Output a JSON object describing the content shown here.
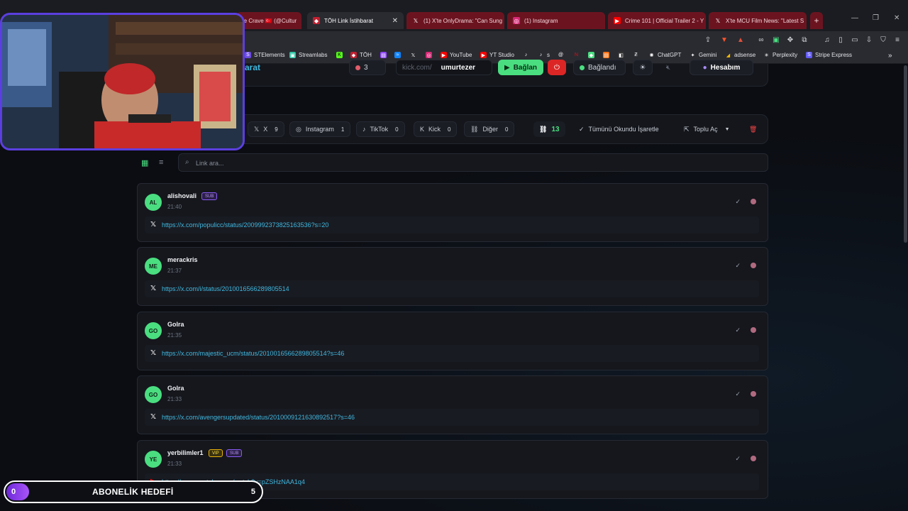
{
  "browser": {
    "tabs": [
      {
        "label": "re Crave 🇹🇷 (@Cultur",
        "active": false
      },
      {
        "label": "TÖH Link İstihbarat",
        "active": true
      },
      {
        "label": "(1) X'te OnlyDrama: \"Can Sung",
        "active": false
      },
      {
        "label": "(1) Instagram",
        "active": false
      },
      {
        "label": "Crime 101 | Official Trailer 2 - Y",
        "active": false
      },
      {
        "label": "X'te MCU Film News: \"Latest S",
        "active": false
      }
    ],
    "bookmarks": [
      "STElements",
      "Streamlabs",
      "",
      "TÖH",
      "",
      "",
      "",
      "",
      "YouTube",
      "YT Studio",
      "",
      "s",
      "",
      "",
      "",
      "",
      "",
      "",
      "ChatGPT",
      "Gemini",
      "adsense",
      "Perplexity",
      "Stripe Express"
    ]
  },
  "app": {
    "title_fragment": "arat",
    "viewer_count": "3",
    "platform_prefix": "kick.com/",
    "channel": "umurtezer",
    "connect_label": "Bağlan",
    "status_label": "Bağlandı",
    "account_label": "Hesabım"
  },
  "filters": {
    "items": [
      {
        "label": "X",
        "count": "9"
      },
      {
        "label": "Instagram",
        "count": "1"
      },
      {
        "label": "TikTok",
        "count": "0"
      },
      {
        "label": "Kick",
        "count": "0"
      },
      {
        "label": "Diğer",
        "count": "0"
      }
    ],
    "total_links": "13",
    "mark_all_read": "Tümünü Okundu İşaretle",
    "bulk_open": "Toplu Aç"
  },
  "search": {
    "placeholder": "Link ara..."
  },
  "messages": [
    {
      "initials": "AL",
      "user": "alishovali",
      "badges": [
        "SUB"
      ],
      "time": "21:40",
      "platform_icon": "x-icon",
      "url": "https://x.com/populicc/status/2009992373825163536?s=20"
    },
    {
      "initials": "ME",
      "user": "merackris",
      "badges": [],
      "time": "21:37",
      "platform_icon": "x-icon",
      "url": "https://x.com/i/status/2010016566289805514"
    },
    {
      "initials": "GO",
      "user": "Golra",
      "badges": [],
      "time": "21:35",
      "platform_icon": "x-icon",
      "url": "https://x.com/majestic_ucm/status/2010016566289805514?s=46"
    },
    {
      "initials": "GO",
      "user": "Golra",
      "badges": [],
      "time": "21:33",
      "platform_icon": "x-icon",
      "url": "https://x.com/avengersupdated/status/2010009121630892517?s=46"
    },
    {
      "initials": "YE",
      "user": "yerbilimler1",
      "badges": [
        "VIP",
        "SUB"
      ],
      "time": "21:33",
      "platform_icon": "youtube-icon",
      "url": "https://www.youtube.com/watch?v=pZSHzNAA1q4"
    }
  ],
  "overlay": {
    "sub_goal_title": "ABONELİK HEDEFİ",
    "sub_goal_current": "0",
    "sub_goal_target": "5"
  },
  "colors": {
    "accent_green": "#4ade80",
    "link_blue": "#3fb8e0",
    "sub_purple": "#8b5cf6",
    "vip_yellow": "#eab308",
    "webcam_border": "#5b3fe0"
  }
}
